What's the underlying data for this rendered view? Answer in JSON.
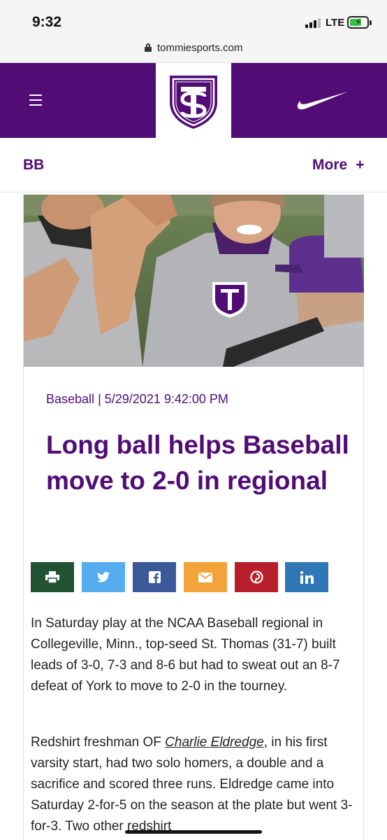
{
  "status_bar": {
    "time": "9:32",
    "network": "LTE",
    "battery_level": 0.7,
    "battery_color": "#3ac24a"
  },
  "browser": {
    "url": "tommiesports.com"
  },
  "header": {
    "brand_color": "#510c76",
    "menu_icon": "hamburger-menu-icon",
    "logo_icon": "tommies-shield-logo-icon",
    "sponsor_icon": "nike-swoosh-icon"
  },
  "subnav": {
    "title": "BB",
    "more_label": "More",
    "more_icon": "+"
  },
  "article": {
    "photo_icon": "baseball-players-celebrating-photo",
    "category": "Baseball",
    "separator": "|",
    "date": "5/29/2021 9:42:00 PM",
    "headline": "Long ball helps Baseball move to 2-0 in regional",
    "share_buttons": [
      {
        "icon": "print-icon",
        "color": "#215232"
      },
      {
        "icon": "twitter-icon",
        "color": "#55acee"
      },
      {
        "icon": "facebook-icon",
        "color": "#3b5998"
      },
      {
        "icon": "email-icon",
        "color": "#f2a33a"
      },
      {
        "icon": "pinterest-icon",
        "color": "#b7202a"
      },
      {
        "icon": "linkedin-icon",
        "color": "#2f77b5"
      }
    ],
    "paragraph1": "In Saturday play at the NCAA Baseball regional in Collegeville, Minn., top-seed St. Thomas (31-7) built leads of 3-0, 7-3 and 8-6 but had to sweat out an 8-7 defeat of York to move to 2-0 in the tourney.",
    "paragraph2_pre": "Redshirt freshman OF ",
    "paragraph2_link": "Charlie Eldredge",
    "paragraph2_post": ", in his first varsity start, had two solo homers, a double and a sacrifice and scored three runs. Eldredge came into Saturday 2-for-5 on the season at the plate but went 3-for-3. Two other redshirt"
  }
}
